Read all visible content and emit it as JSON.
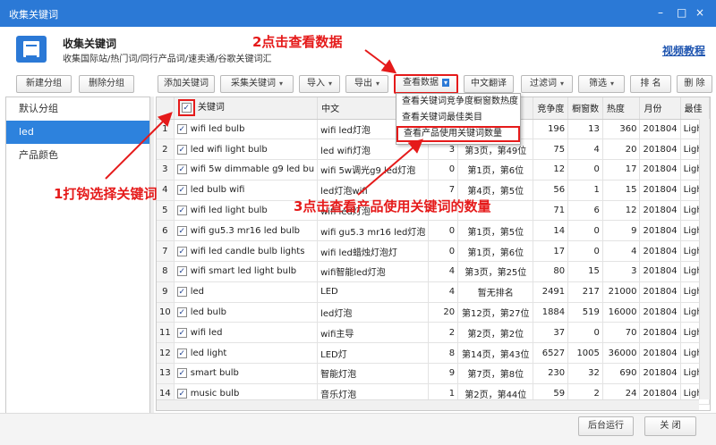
{
  "window": {
    "title": "收集关键词",
    "controls": [
      "–",
      "□",
      "×"
    ]
  },
  "header": {
    "title": "收集关键词",
    "subtitle": "收集国际站/热门词/同行产品词/速卖通/谷歌关键词汇",
    "video_link": "视频教程"
  },
  "left_toolbar": {
    "new_group": "新建分组",
    "delete_group": "删除分组"
  },
  "toolbar": {
    "add_keyword": "添加关键词",
    "collect_keyword": "采集关键词",
    "import": "导入",
    "export": "导出",
    "view_data": "查看数据",
    "translate": "中文翻译",
    "filter_words": "过滤词",
    "filter": "筛选",
    "rank": "排 名",
    "delete": "删 除"
  },
  "sidebar": {
    "items": [
      "默认分组",
      "led",
      "产品颜色"
    ]
  },
  "menu": {
    "items": [
      "查看关键词竞争度橱窗数热度",
      "查看关键词最佳类目",
      "查看产品使用关键词数量"
    ]
  },
  "table": {
    "columns": [
      "",
      "关键词",
      "中文",
      "",
      "",
      "竞争度",
      "橱窗数",
      "热度",
      "月份",
      "最佳"
    ],
    "rows": [
      [
        "1",
        "wifi led bulb",
        "wifi led灯泡",
        "",
        "",
        "196",
        "13",
        "360",
        "201804",
        "Ligh"
      ],
      [
        "2",
        "led wifi light bulb",
        "led wifi灯泡",
        "3",
        "第3页，第49位",
        "75",
        "4",
        "20",
        "201804",
        "Ligh"
      ],
      [
        "3",
        "wifi 5w dimmable g9 led bu",
        "wifi 5w调光g9 led灯泡",
        "0",
        "第1页，第6位",
        "12",
        "0",
        "17",
        "201804",
        "Ligh"
      ],
      [
        "4",
        "led bulb wifi",
        "led灯泡wifi",
        "7",
        "第4页，第5位",
        "56",
        "1",
        "15",
        "201804",
        "Ligh"
      ],
      [
        "5",
        "wifi led light bulb",
        "wifi led灯泡",
        "",
        "",
        "71",
        "6",
        "12",
        "201804",
        "Ligh"
      ],
      [
        "6",
        "wifi gu5.3 mr16 led bulb",
        "wifi gu5.3 mr16 led灯泡",
        "0",
        "第1页，第5位",
        "14",
        "0",
        "9",
        "201804",
        "Ligh"
      ],
      [
        "7",
        "wifi led candle bulb lights",
        "wifi led蜡烛灯泡灯",
        "0",
        "第1页，第6位",
        "17",
        "0",
        "4",
        "201804",
        "Ligh"
      ],
      [
        "8",
        "wifi smart led light bulb",
        "wifi智能led灯泡",
        "4",
        "第3页，第25位",
        "80",
        "15",
        "3",
        "201804",
        "Ligh"
      ],
      [
        "9",
        "led",
        "LED",
        "4",
        "暂无排名",
        "2491",
        "217",
        "21000",
        "201804",
        "Ligh"
      ],
      [
        "10",
        "led bulb",
        "led灯泡",
        "20",
        "第12页，第27位",
        "1884",
        "519",
        "16000",
        "201804",
        "Ligh"
      ],
      [
        "11",
        "wifi led",
        "wifi主导",
        "2",
        "第2页，第2位",
        "37",
        "0",
        "70",
        "201804",
        "Ligh"
      ],
      [
        "12",
        "led light",
        "LED灯",
        "8",
        "第14页，第43位",
        "6527",
        "1005",
        "36000",
        "201804",
        "Ligh"
      ],
      [
        "13",
        "smart bulb",
        "智能灯泡",
        "9",
        "第7页，第8位",
        "230",
        "32",
        "690",
        "201804",
        "Ligh"
      ],
      [
        "14",
        "music bulb",
        "音乐灯泡",
        "1",
        "第2页，第44位",
        "59",
        "2",
        "24",
        "201804",
        "Ligh"
      ]
    ]
  },
  "annotations": {
    "step1": "1打钩选择关键词",
    "step2": "2点击查看数据",
    "step3": "3点击查看产品使用关键词的数量"
  },
  "footer": {
    "run_background": "后台运行",
    "close": "关 闭"
  },
  "colors": {
    "titlebar": "#2b79d6",
    "selected": "#2d82dd",
    "annotation": "#e51a1a"
  }
}
